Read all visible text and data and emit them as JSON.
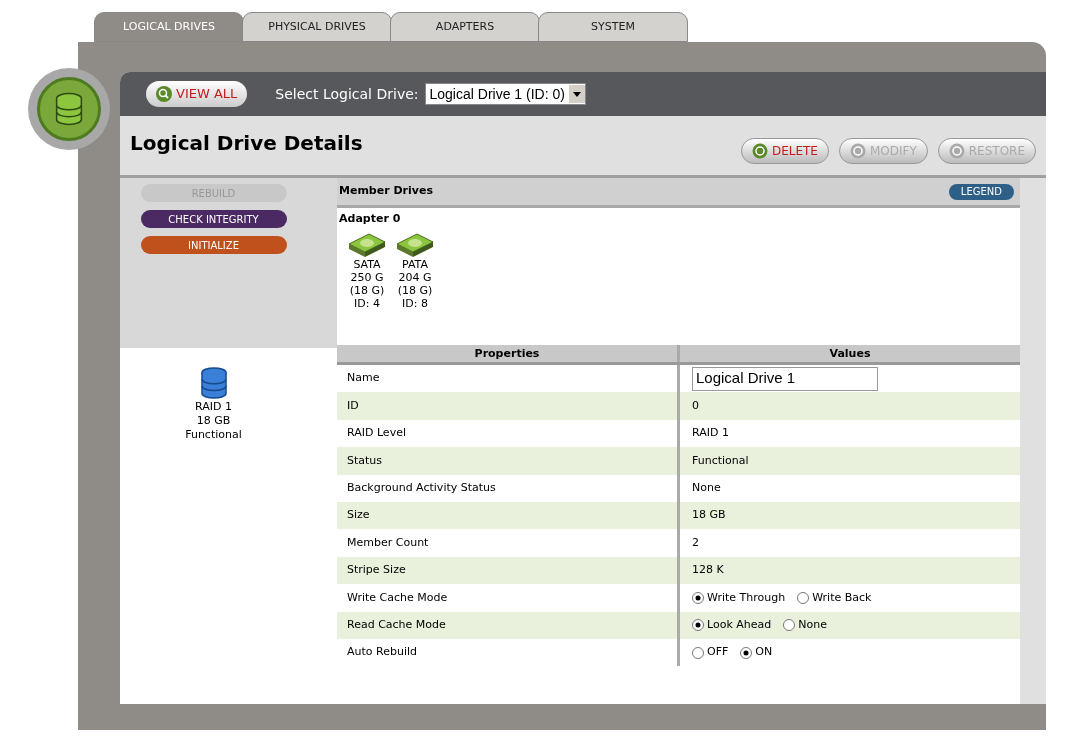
{
  "tabs": [
    {
      "label": "LOGICAL DRIVES",
      "selected": true
    },
    {
      "label": "PHYSICAL DRIVES",
      "selected": false
    },
    {
      "label": "ADAPTERS",
      "selected": false
    },
    {
      "label": "SYSTEM",
      "selected": false
    }
  ],
  "toolbar": {
    "view_all": "VIEW ALL",
    "select_label": "Select Logical Drive:",
    "select_value": "Logical Drive 1 (ID: 0)"
  },
  "title": "Logical Drive Details",
  "actions": [
    {
      "label": "DELETE",
      "disabled": false
    },
    {
      "label": "MODIFY",
      "disabled": true
    },
    {
      "label": "RESTORE",
      "disabled": true
    }
  ],
  "side_buttons": [
    {
      "label": "REBUILD",
      "color": "#c8c8c8",
      "disabled": true
    },
    {
      "label": "CHECK INTEGRITY",
      "color": "#4b2a63",
      "disabled": false
    },
    {
      "label": "INITIALIZE",
      "color": "#c0501c",
      "disabled": false
    }
  ],
  "drive_summary": [
    "RAID 1",
    "18 GB",
    "Functional"
  ],
  "member_drives": {
    "title": "Member Drives",
    "legend": "LEGEND",
    "adapter": "Adapter 0",
    "drives": [
      {
        "lines": [
          "SATA",
          "250 G",
          "(18 G)",
          "ID: 4"
        ]
      },
      {
        "lines": [
          "PATA",
          "204 G",
          "(18 G)",
          "ID: 8"
        ]
      }
    ]
  },
  "table": {
    "columns": [
      "Properties",
      "Values"
    ],
    "rows": [
      {
        "property": "Name",
        "kind": "input",
        "value": "Logical Drive 1"
      },
      {
        "property": "ID",
        "kind": "text",
        "value": "0"
      },
      {
        "property": "RAID Level",
        "kind": "text",
        "value": "RAID 1"
      },
      {
        "property": "Status",
        "kind": "text",
        "value": "Functional"
      },
      {
        "property": "Background Activity Status",
        "kind": "text",
        "value": "None"
      },
      {
        "property": "Size",
        "kind": "text",
        "value": "18 GB"
      },
      {
        "property": "Member Count",
        "kind": "text",
        "value": "2"
      },
      {
        "property": "Stripe Size",
        "kind": "text",
        "value": "128 K"
      },
      {
        "property": "Write Cache Mode",
        "kind": "radio",
        "options": [
          {
            "label": "Write Through",
            "selected": true
          },
          {
            "label": "Write Back",
            "selected": false
          }
        ]
      },
      {
        "property": "Read Cache Mode",
        "kind": "radio",
        "options": [
          {
            "label": "Look Ahead",
            "selected": true
          },
          {
            "label": "None",
            "selected": false
          }
        ]
      },
      {
        "property": "Auto Rebuild",
        "kind": "radio",
        "options": [
          {
            "label": "OFF",
            "selected": false
          },
          {
            "label": "ON",
            "selected": true
          }
        ]
      }
    ]
  }
}
